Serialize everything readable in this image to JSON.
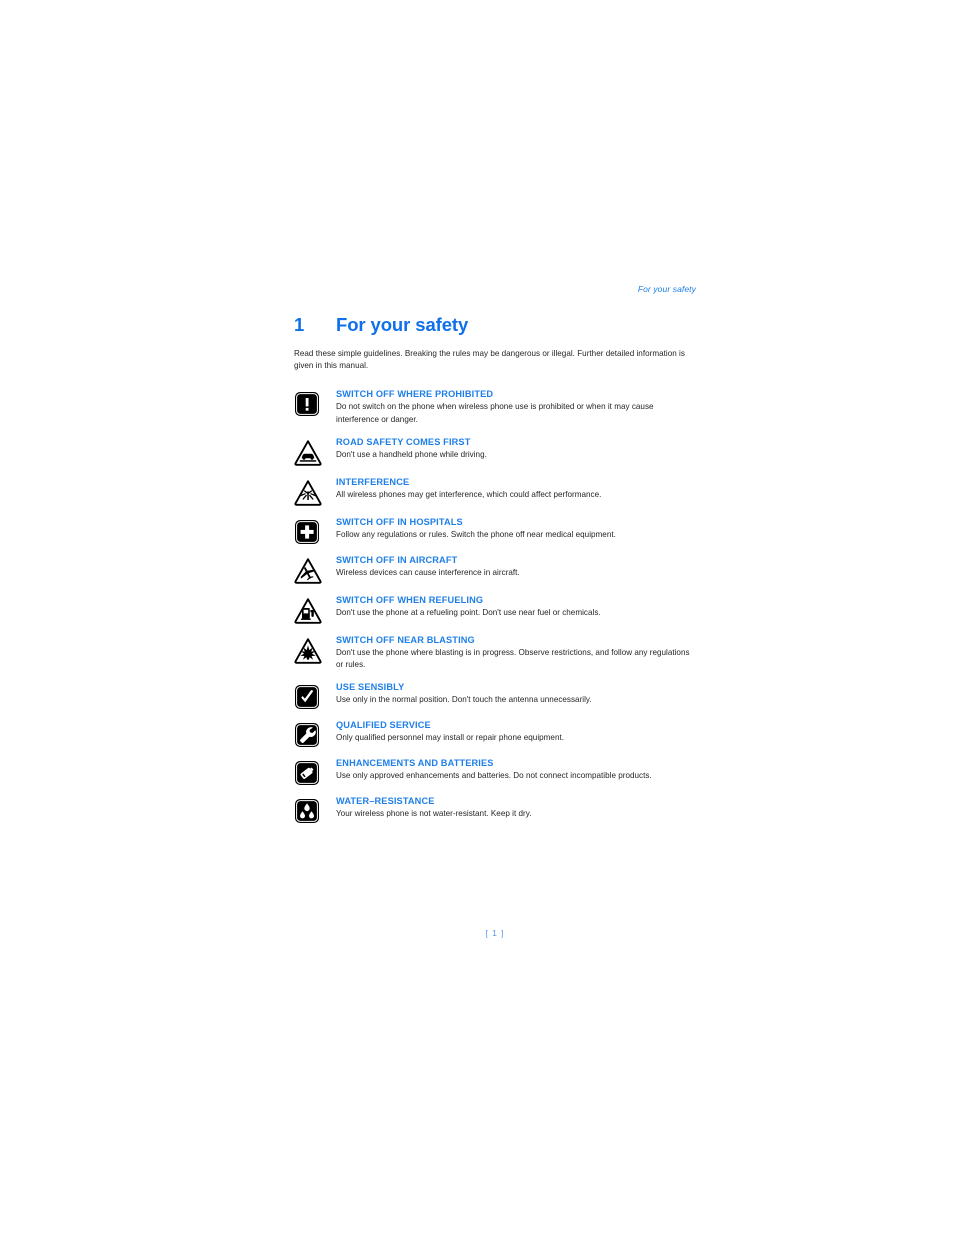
{
  "header": {
    "running_head": "For your safety"
  },
  "title": {
    "number": "1",
    "text": "For your safety"
  },
  "intro": "Read these simple guidelines. Breaking the rules may be dangerous or illegal. Further detailed information is given in this manual.",
  "colors": {
    "heading_blue": "#1E7FE8",
    "title_blue": "#1070EA",
    "body_text": "#262626",
    "page_number_blue": "#4A94EE"
  },
  "items": [
    {
      "icon": "exclamation-square-icon",
      "icon_shape": "square",
      "heading": "SWITCH OFF WHERE PROHIBITED",
      "body": "Do not switch on the phone when wireless phone use is prohibited or when it may cause interference or danger."
    },
    {
      "icon": "car-triangle-icon",
      "icon_shape": "triangle",
      "heading": "ROAD SAFETY COMES FIRST",
      "body": "Don't use a handheld phone while driving."
    },
    {
      "icon": "interference-triangle-icon",
      "icon_shape": "triangle",
      "heading": "INTERFERENCE",
      "body": "All wireless phones may get interference, which could affect performance."
    },
    {
      "icon": "hospital-cross-square-icon",
      "icon_shape": "square",
      "heading": "SWITCH OFF IN HOSPITALS",
      "body": "Follow any regulations or rules. Switch the phone off near medical equipment."
    },
    {
      "icon": "airplane-triangle-icon",
      "icon_shape": "triangle",
      "heading": "SWITCH OFF IN AIRCRAFT",
      "body": "Wireless devices can cause interference in aircraft."
    },
    {
      "icon": "fuel-pump-triangle-icon",
      "icon_shape": "triangle",
      "heading": "SWITCH OFF WHEN REFUELING",
      "body": "Don't use the phone at a refueling point. Don't use near fuel or chemicals."
    },
    {
      "icon": "blasting-triangle-icon",
      "icon_shape": "triangle",
      "heading": "SWITCH OFF NEAR BLASTING",
      "body": "Don't use the phone where blasting is in progress. Observe restrictions, and follow any regulations or rules."
    },
    {
      "icon": "checkmark-square-icon",
      "icon_shape": "square",
      "heading": "USE SENSIBLY",
      "body": "Use only in the normal position. Don't touch the antenna unnecessarily."
    },
    {
      "icon": "wrench-square-icon",
      "icon_shape": "square",
      "heading": "QUALIFIED SERVICE",
      "body": "Only qualified personnel may install or repair phone equipment."
    },
    {
      "icon": "battery-square-icon",
      "icon_shape": "square",
      "heading": "ENHANCEMENTS AND BATTERIES",
      "body": "Use only approved enhancements and batteries. Do not connect incompatible products."
    },
    {
      "icon": "water-drops-square-icon",
      "icon_shape": "square",
      "heading": "WATER–RESISTANCE",
      "body": "Your wireless phone is not water-resistant. Keep it dry."
    }
  ],
  "footer": {
    "page_number": "[ 1 ]"
  }
}
